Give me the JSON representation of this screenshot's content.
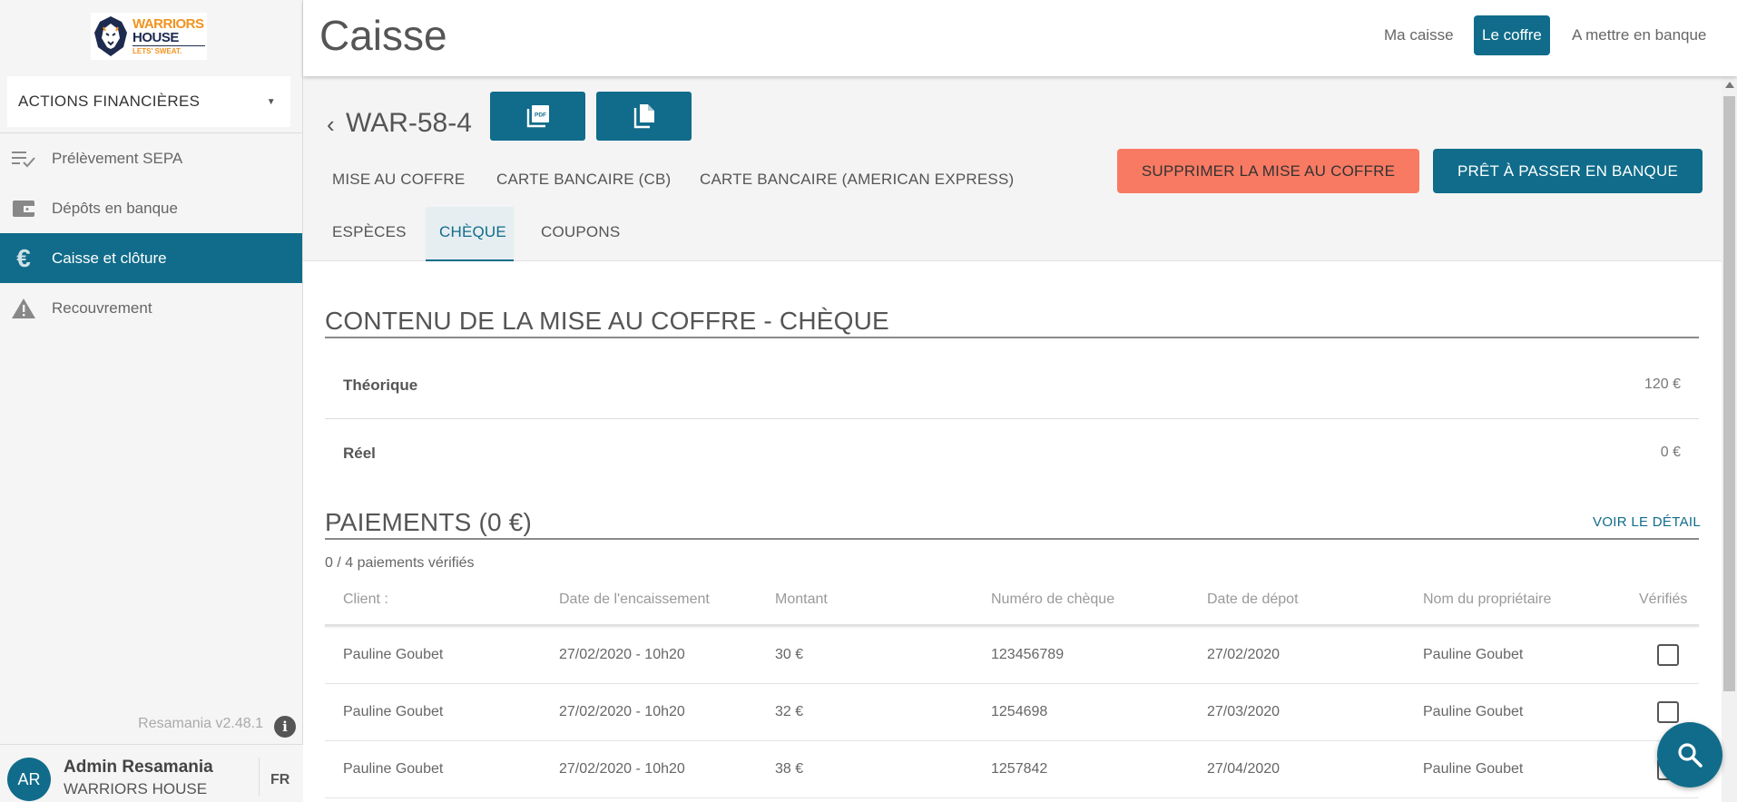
{
  "brand": {
    "line1": "WARRIORS",
    "line2": "HOUSE",
    "tagline": "LETS' SWEAT."
  },
  "sidebar": {
    "select_label": "ACTIONS FINANCIÈRES",
    "items": [
      {
        "label": "Prélèvement SEPA",
        "icon": "list-check-icon",
        "active": false
      },
      {
        "label": "Dépôts en banque",
        "icon": "wallet-icon",
        "active": false
      },
      {
        "label": "Caisse et clôture",
        "icon": "euro-icon",
        "active": true
      },
      {
        "label": "Recouvrement",
        "icon": "warning-icon",
        "active": false
      }
    ],
    "version": "Resamania v2.48.1"
  },
  "user": {
    "initials": "AR",
    "name": "Admin Resamania",
    "org": "WARRIORS HOUSE",
    "lang": "FR"
  },
  "header": {
    "title": "Caisse",
    "tabs": [
      {
        "label": "Ma caisse",
        "active": false
      },
      {
        "label": "Le coffre",
        "active": true
      },
      {
        "label": "A mettre en banque",
        "active": false
      }
    ]
  },
  "detail": {
    "reference": "WAR-58-4",
    "tabs_row1": [
      "MISE AU COFFRE",
      "CARTE BANCAIRE (CB)",
      "CARTE BANCAIRE (AMERICAN EXPRESS)"
    ],
    "tabs_row2": [
      "ESPÈCES",
      "CHÈQUE",
      "COUPONS"
    ],
    "active_tab": "CHÈQUE",
    "delete_button": "SUPPRIMER LA MISE AU COFFRE",
    "bank_button": "PRÊT À PASSER EN BANQUE"
  },
  "content": {
    "title": "CONTENU DE LA MISE AU COFFRE - CHÈQUE",
    "theorique_label": "Théorique",
    "theorique_value": "120 €",
    "reel_label": "Réel",
    "reel_value": "0 €"
  },
  "payments": {
    "title": "PAIEMENTS (0 €)",
    "voir_detail": "VOIR LE DÉTAIL",
    "verified_count": "0 / 4 paiements vérifiés",
    "columns": [
      "Client :",
      "Date de l'encaissement",
      "Montant",
      "Numéro de chèque",
      "Date de dépot",
      "Nom du propriétaire",
      "Vérifiés"
    ],
    "rows": [
      {
        "client": "Pauline Goubet",
        "date_encaissement": "27/02/2020 - 10h20",
        "montant": "30 €",
        "numero": "123456789",
        "date_depot": "27/02/2020",
        "proprietaire": "Pauline Goubet",
        "verifie": false
      },
      {
        "client": "Pauline Goubet",
        "date_encaissement": "27/02/2020 - 10h20",
        "montant": "32 €",
        "numero": "1254698",
        "date_depot": "27/03/2020",
        "proprietaire": "Pauline Goubet",
        "verifie": false
      },
      {
        "client": "Pauline Goubet",
        "date_encaissement": "27/02/2020 - 10h20",
        "montant": "38 €",
        "numero": "1257842",
        "date_depot": "27/04/2020",
        "proprietaire": "Pauline Goubet",
        "verifie": false
      }
    ]
  },
  "colors": {
    "primary": "#106c8a",
    "danger": "#f97a63",
    "brand_orange": "#f0931f",
    "brand_navy": "#1d2b4f"
  }
}
